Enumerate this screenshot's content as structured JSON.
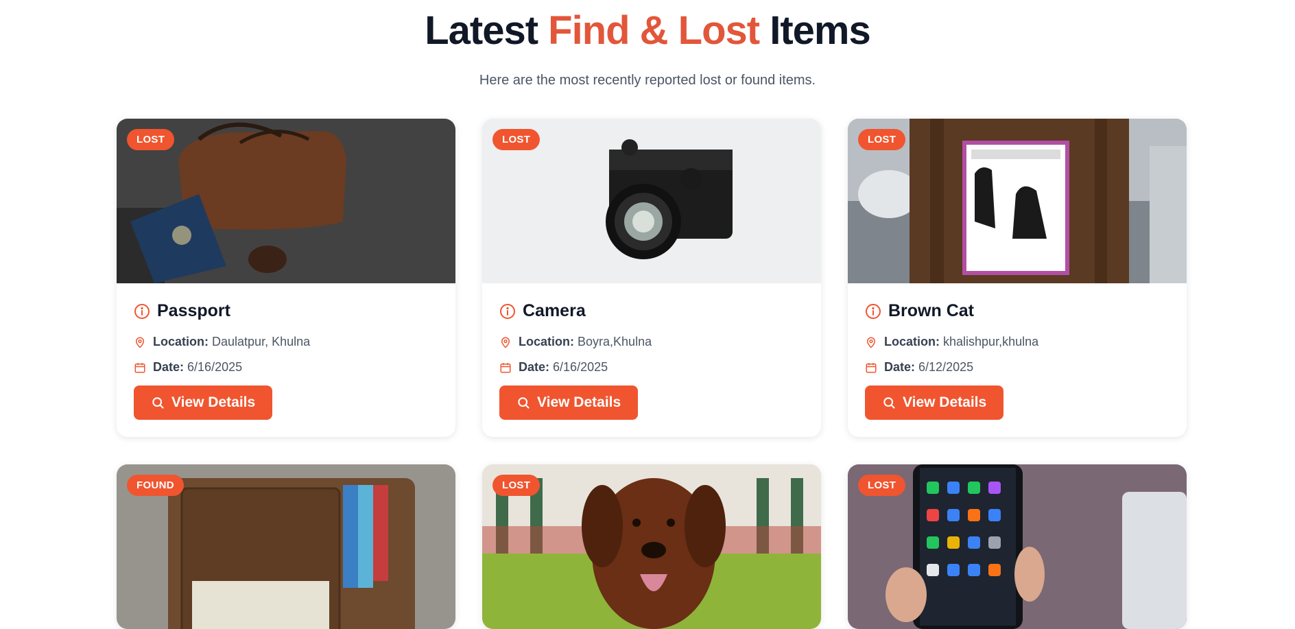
{
  "header": {
    "title_part1": "Latest",
    "title_accent": "Find & Lost",
    "title_part2": "Items",
    "subtitle": "Here are the most recently reported lost or found items."
  },
  "labels": {
    "location": "Location:",
    "date": "Date:",
    "view_details": "View Details"
  },
  "colors": {
    "accent": "#f0552f",
    "title_accent": "#e2563a"
  },
  "icons": [
    "info-icon",
    "map-pin-icon",
    "calendar-icon",
    "search-icon"
  ],
  "cards": [
    {
      "status": "LOST",
      "title": "Passport",
      "location": "Daulatpur, Khulna",
      "date": "6/16/2025",
      "image": "passport-photo"
    },
    {
      "status": "LOST",
      "title": "Camera",
      "location": "Boyra,Khulna",
      "date": "6/16/2025",
      "image": "camera-photo"
    },
    {
      "status": "LOST",
      "title": "Brown Cat",
      "location": "khalishpur,khulna",
      "date": "6/12/2025",
      "image": "missing-cat-poster-photo"
    },
    {
      "status": "FOUND",
      "image": "wallet-photo"
    },
    {
      "status": "LOST",
      "image": "dog-photo"
    },
    {
      "status": "LOST",
      "image": "smartphone-photo"
    }
  ]
}
